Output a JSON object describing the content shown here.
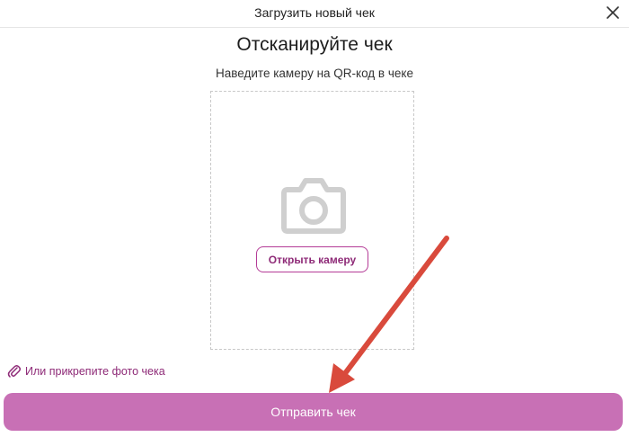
{
  "header": {
    "title": "Загрузить новый чек",
    "close_icon": "close-icon"
  },
  "scan": {
    "title": "Отсканируйте чек",
    "subtitle": "Наведите камеру на QR-код в чеке",
    "camera_icon": "camera-icon",
    "open_camera_label": "Открыть камеру"
  },
  "attach": {
    "icon": "paperclip-icon",
    "label": "Или прикрепите фото чека"
  },
  "submit": {
    "label": "Отправить чек"
  },
  "colors": {
    "accent": "#8e2a77",
    "button_bg": "#c870b5",
    "annotation_arrow": "#d94a3c"
  }
}
